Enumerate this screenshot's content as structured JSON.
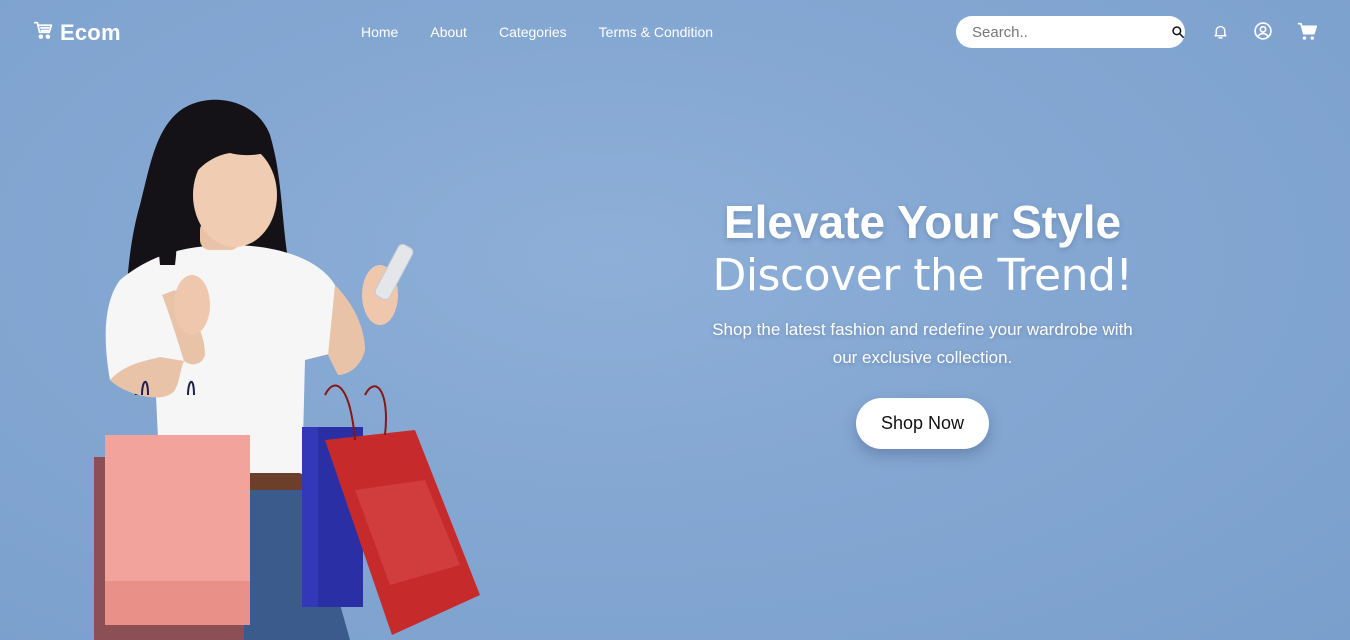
{
  "brand": {
    "name": "Ecom",
    "icon": "shopping-cart-icon"
  },
  "nav": {
    "links": [
      {
        "label": "Home"
      },
      {
        "label": "About"
      },
      {
        "label": "Categories"
      },
      {
        "label": "Terms & Condition"
      }
    ]
  },
  "search": {
    "placeholder": "Search..",
    "value": "",
    "icon": "search-icon"
  },
  "header_icons": [
    "bell-icon",
    "user-circle-icon",
    "cart-icon"
  ],
  "hero": {
    "headline": "Elevate Your Style",
    "subheadline": "Discover the Trend!",
    "tagline_line1": "Shop the latest fashion and redefine your wardrobe with",
    "tagline_line2": "our exclusive collection.",
    "cta_label": "Shop Now"
  },
  "colors": {
    "background": "#84a7d2",
    "text": "#ffffff",
    "button_bg": "#ffffff",
    "button_text": "#111111"
  }
}
